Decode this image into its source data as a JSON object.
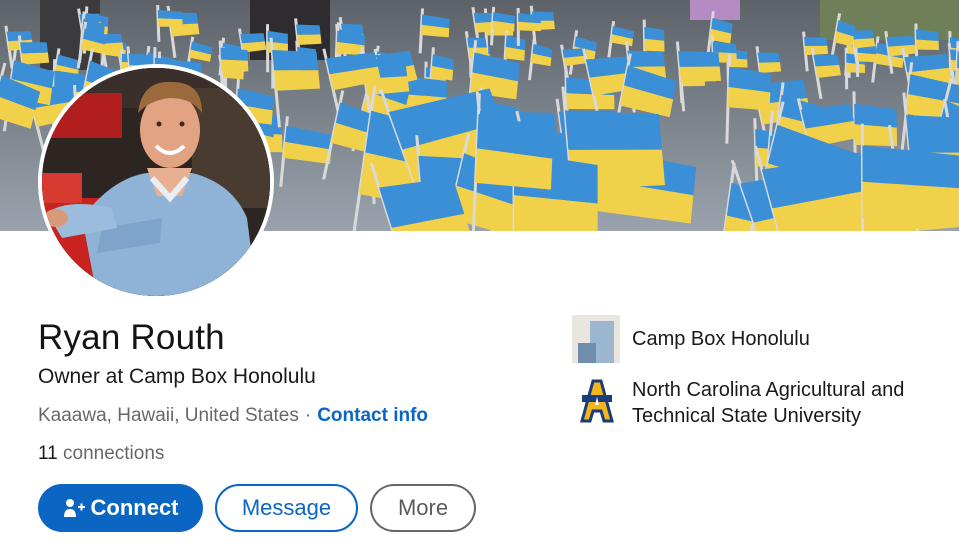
{
  "profile": {
    "name": "Ryan Routh",
    "headline": "Owner at Camp Box Honolulu",
    "location": "Kaaawa, Hawaii, United States",
    "separator": "·",
    "contact_info_label": "Contact info",
    "connections_count": "11",
    "connections_label": "connections"
  },
  "actions": {
    "connect_label": "Connect",
    "message_label": "Message",
    "more_label": "More"
  },
  "sidebar": {
    "experience": {
      "name": "Camp Box Honolulu",
      "logo_icon": "company-placeholder-icon"
    },
    "education": {
      "name": "North Carolina Agricultural and Technical State University",
      "logo_icon": "aggie-university-logo"
    }
  },
  "colors": {
    "brand_blue": "#0a66c2",
    "flag_blue": "#3a8fd6",
    "flag_yellow": "#f2d14a"
  }
}
